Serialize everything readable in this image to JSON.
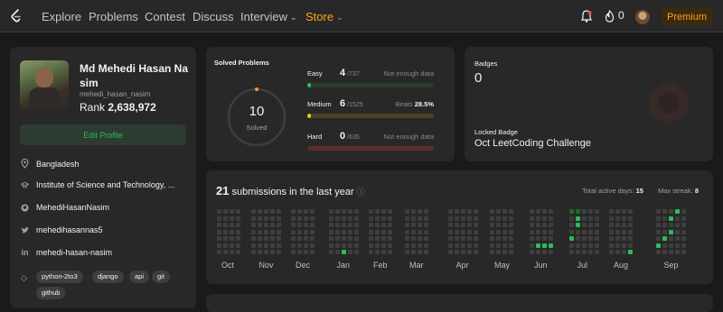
{
  "nav": {
    "items": [
      "Explore",
      "Problems",
      "Contest",
      "Discuss",
      "Interview",
      "Store"
    ],
    "fire_count": "0",
    "premium_label": "Premium",
    "colors": {
      "accent": "#ffa116",
      "easy": "#2cbb5d",
      "medium": "#ffc01e",
      "hard": "#ef4743"
    }
  },
  "profile": {
    "name": "Md Mehedi Hasan Nasim",
    "username": "mehedi_hasan_nasim",
    "rank_label": "Rank",
    "rank_value": "2,638,972",
    "edit_label": "Edit Profile",
    "info": [
      {
        "icon": "location-icon",
        "text": "Bangladesh"
      },
      {
        "icon": "school-icon",
        "text": "Institute of Science and Technology, ..."
      },
      {
        "icon": "github-icon",
        "text": "MehediHasanNasim"
      },
      {
        "icon": "twitter-icon",
        "text": "mehedihasannas5"
      },
      {
        "icon": "linkedin-icon",
        "text": "mehedi-hasan-nasim"
      }
    ],
    "tags": [
      "python-2to3",
      "django",
      "api",
      "git",
      "github"
    ]
  },
  "solved": {
    "title": "Solved Problems",
    "total": "10",
    "total_label": "Solved",
    "difficulties": [
      {
        "label": "Easy",
        "solved": "4",
        "total": "/737",
        "note": "Not enough data",
        "fraction": 0.0054
      },
      {
        "label": "Medium",
        "solved": "6",
        "total": "/1525",
        "note_label": "Beats",
        "note_value": "28.5%",
        "fraction": 0.0039
      },
      {
        "label": "Hard",
        "solved": "0",
        "total": "/635",
        "note": "Not enough data",
        "fraction": 0
      }
    ]
  },
  "badges": {
    "title": "Badges",
    "count": "0",
    "locked_label": "Locked Badge",
    "locked_name": "Oct LeetCoding Challenge"
  },
  "submissions": {
    "count": "21",
    "label": "submissions in the last year",
    "active_label": "Total active days:",
    "active_value": "15",
    "streak_label": "Max streak:",
    "streak_value": "8",
    "months": [
      "Oct",
      "Nov",
      "Dec",
      "Jan",
      "Feb",
      "Mar",
      "Apr",
      "May",
      "Jun",
      "Jul",
      "Aug",
      "Sep"
    ]
  }
}
